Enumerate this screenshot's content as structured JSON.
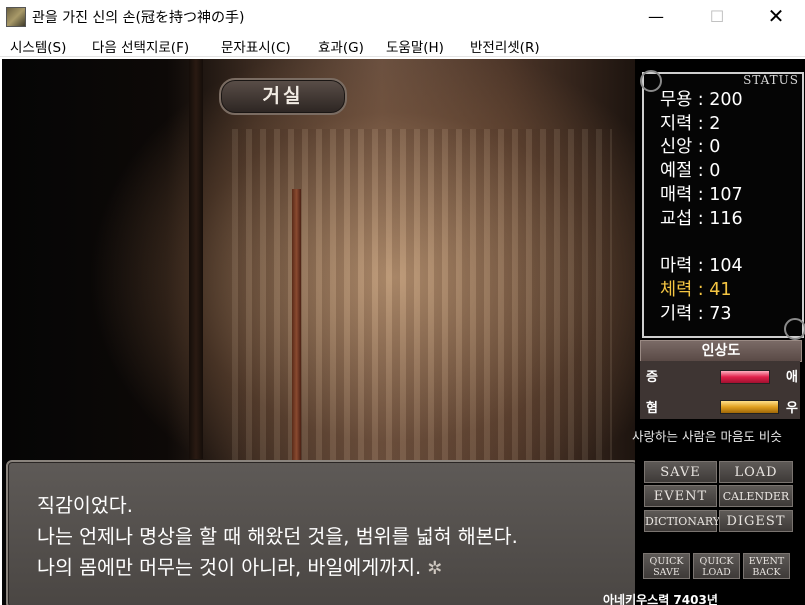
{
  "window": {
    "title": "관을 가진 신의 손(冠を持つ神の手)",
    "minimize_glyph": "—",
    "maximize_glyph": "☐",
    "close_glyph": "✕"
  },
  "menu": [
    {
      "label": "시스템(S)"
    },
    {
      "label": "다음 선택지로(F)"
    },
    {
      "label": "문자표시(C)"
    },
    {
      "label": "효과(G)"
    },
    {
      "label": "도움말(H)"
    },
    {
      "label": "반전리셋(R)"
    }
  ],
  "scene": {
    "location": "거실"
  },
  "dialog": {
    "lines": [
      "직감이었다.",
      "나는 언제나 명상을 할 때 해왔던 것을, 범위를 넓혀 해본다.",
      "나의 몸에만 머무는 것이 아니라, 바일에게까지."
    ],
    "next_glyph": "✲"
  },
  "status": {
    "title": "STATUS",
    "stats": [
      {
        "label": "무용",
        "value": "200"
      },
      {
        "label": "지력",
        "value": "2"
      },
      {
        "label": "신앙",
        "value": "0"
      },
      {
        "label": "예절",
        "value": "0"
      },
      {
        "label": "매력",
        "value": "107"
      },
      {
        "label": "교섭",
        "value": "116"
      },
      {
        "label": "마력",
        "value": "104"
      },
      {
        "label": "체력",
        "value": "41",
        "highlight": true
      },
      {
        "label": "기력",
        "value": "73"
      }
    ],
    "separator": " : ",
    "highlight_color": "#f4c542"
  },
  "affinity": {
    "title": "인상도",
    "love_left": "증",
    "love_right": "애",
    "love_level": 0.8,
    "friend_left": "혐",
    "friend_right": "우",
    "friend_level": 0.95,
    "ticker": "사랑하는 사람은 마음도 비슷"
  },
  "buttons": {
    "save": "SAVE",
    "load": "LOAD",
    "event": "EVENT",
    "calender": "CALENDER",
    "dictionary": "DICTIONARY",
    "digest": "DIGEST",
    "quick_save": [
      "QUICK",
      "SAVE"
    ],
    "quick_load": [
      "QUICK",
      "LOAD"
    ],
    "event_back": [
      "EVENT",
      "BACK"
    ]
  },
  "date": "아네키우스력 7403년"
}
